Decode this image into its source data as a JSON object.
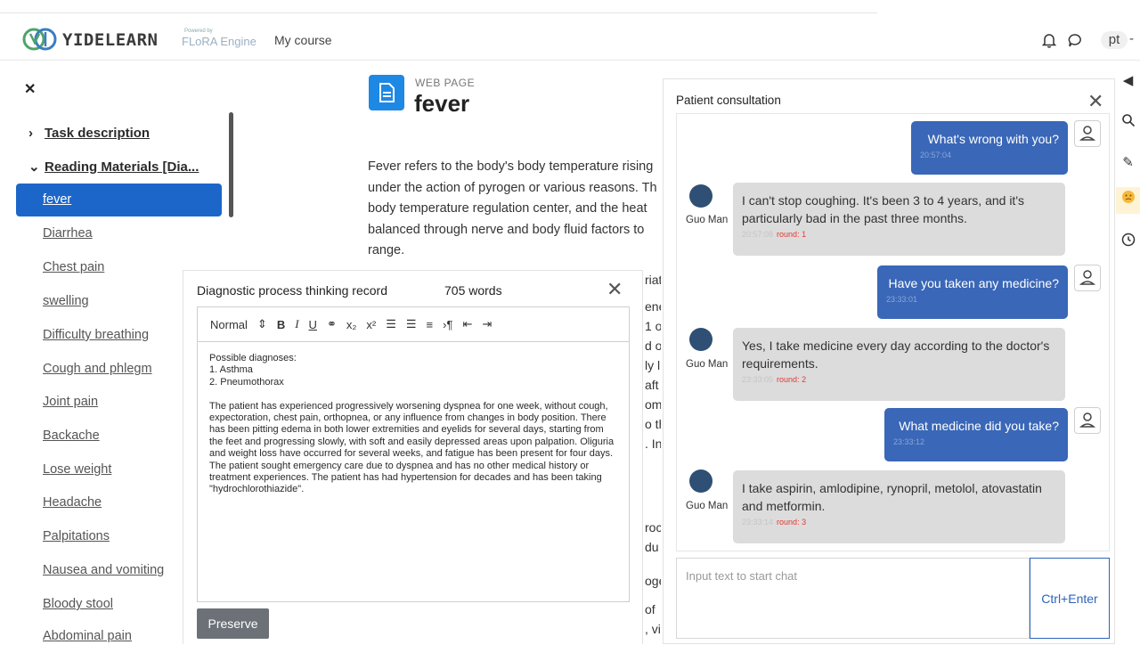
{
  "header": {
    "brand": "YIDELEARN",
    "engine_sub": "Powered by",
    "engine": "FLoRA Engine",
    "my_course": "My course",
    "user_initials": "pt"
  },
  "drawer": {
    "sections": [
      {
        "label": "Task description",
        "expanded": false
      },
      {
        "label": "Reading Materials [Dia...",
        "expanded": true
      }
    ],
    "items": [
      "fever",
      "Diarrhea",
      "Chest pain",
      "swelling",
      "Difficulty breathing",
      "Cough and phlegm",
      "Joint pain",
      "Backache",
      "Lose weight",
      "Headache",
      "Palpitations",
      "Nausea and vomiting",
      "Bloody stool",
      "Abdominal pain"
    ],
    "active_item": "fever"
  },
  "page": {
    "type_label": "WEB PAGE",
    "title": "fever",
    "paragraph_lines": [
      "Fever refers to the body's body temperature rising",
      "under the action of pyrogen or various reasons. Th",
      "body temperature regulation center, and the heat",
      "balanced through nerve and body fluid factors to",
      "range."
    ],
    "peek_lines": [
      "riat",
      "ene",
      "1 o",
      "d of",
      "ly l",
      "aft",
      "ome",
      "o th",
      ". In",
      "roc",
      "du",
      "oge",
      "of",
      ", vi"
    ]
  },
  "diagnostic": {
    "title": "Diagnostic process thinking record",
    "word_count": "705 words",
    "toolbar_style": "Normal",
    "body": "Possible diagnoses:\n1. Asthma\n2. Pneumothorax\n\nThe patient has experienced progressively worsening dyspnea for one week, without cough, expectoration, chest pain, orthopnea, or any influence from changes in body position. There has been pitting edema in both lower extremities and eyelids for several days, starting from the feet and progressing slowly, with soft and easily depressed areas upon palpation. Oliguria and weight loss have occurred for several weeks, and fatigue has been present for four days. The patient sought emergency care due to dyspnea and has no other medical history or treatment experiences. The patient has had hypertension for decades and has been taking \"hydrochlorothiazide\".",
    "preserve_label": "Preserve"
  },
  "chat": {
    "title": "Patient consultation",
    "messages": [
      {
        "from": "user",
        "text": "What's wrong with you?",
        "time": "20:57:04"
      },
      {
        "from": "patient",
        "name": "Guo Man",
        "text": "I can't stop coughing. It's been 3 to 4 years, and it's particularly bad in the past three months.",
        "time": "20:57:08",
        "round": "round: 1"
      },
      {
        "from": "user",
        "text": "Have you taken any medicine?",
        "time": "23:33:01"
      },
      {
        "from": "patient",
        "name": "Guo Man",
        "text": "Yes, I take medicine every day according to the doctor's requirements.",
        "time": "23:33:05",
        "round": "round: 2"
      },
      {
        "from": "user",
        "text": "What medicine did you take?",
        "time": "23:33:12"
      },
      {
        "from": "patient",
        "name": "Guo Man",
        "text": "I take aspirin, amlodipine, rynopril, metolol, atovastatin and metformin.",
        "time": "23:33:14",
        "round": "round: 3"
      }
    ],
    "input_placeholder": "Input text to start chat",
    "send_label": "Ctrl+Enter"
  },
  "colors": {
    "accent": "#1d66c9",
    "bubble_user": "#3a67b7",
    "bubble_patient": "#dcdcdc",
    "round_red": "#e53935"
  }
}
